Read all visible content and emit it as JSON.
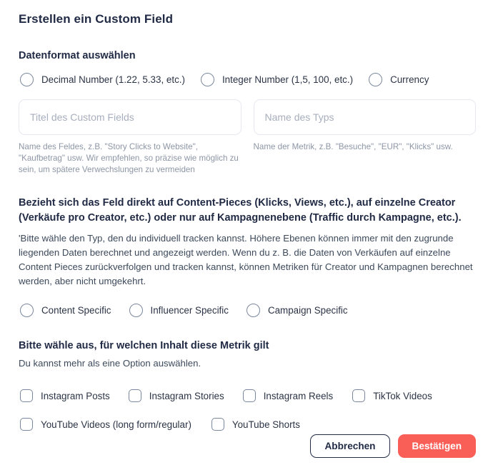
{
  "dialog": {
    "title": "Erstellen ein Custom Field"
  },
  "format_section": {
    "heading": "Datenformat auswählen",
    "options": [
      {
        "label": "Decimal Number (1.22, 5.33, etc.)",
        "icon": "radio-icon",
        "selected": false
      },
      {
        "label": "Integer Number (1,5, 100, etc.)",
        "icon": "radio-icon",
        "selected": false
      },
      {
        "label": "Currency",
        "icon": "radio-icon",
        "selected": false
      }
    ]
  },
  "fields": {
    "title_field": {
      "placeholder": "Titel des Custom Fields",
      "value": "",
      "helper": "Name des Feldes, z.B. \"Story Clicks to Website\", \"Kaufbetrag\" usw. Wir empfehlen, so präzise wie möglich zu sein, um spätere Verwechslungen zu vermeiden"
    },
    "type_field": {
      "placeholder": "Name des Typs",
      "value": "",
      "helper": "Name der Metrik, z.B. \"Besuche\", \"EUR\", \"Klicks\" usw."
    }
  },
  "scope_section": {
    "heading": "Bezieht sich das Feld direkt auf Content-Pieces (Klicks, Views, etc.), auf einzelne Creator (Verkäufe pro Creator, etc.) oder nur auf Kampagnenebene (Traffic durch Kampagne, etc.).",
    "paragraph": "'Bitte wähle den Typ, den du individuell tracken kannst. Höhere Ebenen können immer mit den zugrunde liegenden Daten berechnet und angezeigt werden. Wenn du z. B. die Daten von Verkäufen auf einzelne Content Pieces zurückverfolgen und tracken kannst, können Metriken für Creator und Kampagnen berechnet werden, aber nicht umgekehrt.",
    "options": [
      {
        "label": "Content Specific",
        "icon": "radio-icon",
        "selected": false
      },
      {
        "label": "Influencer Specific",
        "icon": "radio-icon",
        "selected": false
      },
      {
        "label": "Campaign Specific",
        "icon": "radio-icon",
        "selected": false
      }
    ]
  },
  "content_section": {
    "heading": "Bitte wähle aus, für welchen Inhalt diese Metrik gilt",
    "subtext": "Du kannst mehr als eine Option auswählen.",
    "options_row1": [
      {
        "label": "Instagram Posts",
        "icon": "checkbox-icon",
        "checked": false
      },
      {
        "label": "Instagram Stories",
        "icon": "checkbox-icon",
        "checked": false
      },
      {
        "label": "Instagram Reels",
        "icon": "checkbox-icon",
        "checked": false
      },
      {
        "label": "TikTok Videos",
        "icon": "checkbox-icon",
        "checked": false
      }
    ],
    "options_row2": [
      {
        "label": "YouTube Videos (long form/regular)",
        "icon": "checkbox-icon",
        "checked": false
      },
      {
        "label": "YouTube Shorts",
        "icon": "checkbox-icon",
        "checked": false
      }
    ]
  },
  "footer": {
    "cancel_label": "Abbrechen",
    "confirm_label": "Bestätigen"
  },
  "colors": {
    "accent": "#fa5f57",
    "text_primary": "#222b45",
    "text_muted": "#8d96a6",
    "control_border": "#7a879c",
    "input_border": "#e6e8ee"
  }
}
